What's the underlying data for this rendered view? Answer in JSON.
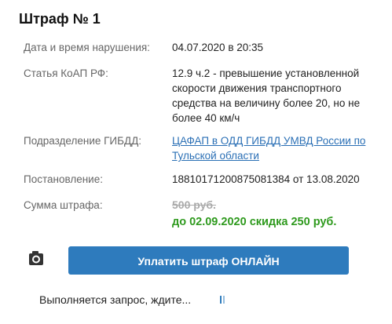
{
  "fine": {
    "title": "Штраф № 1",
    "rows": [
      {
        "label": "Дата и время нарушения:",
        "value": "04.07.2020 в 20:35"
      },
      {
        "label": "Статья КоАП РФ:",
        "value": "12.9 ч.2 - превышение установленной скорости движения транспортного средства на величину более 20, но не более 40 км/ч"
      },
      {
        "label": "Подразделение ГИБДД:",
        "value": "ЦАФАП в ОДД ГИБДД УМВД России по Тульской области"
      },
      {
        "label": "Постановление:",
        "value": "18810171200875081384 от 13.08.2020"
      },
      {
        "label": "Сумма штрафа:",
        "old_amount": "500 руб.",
        "discount_text": "до 02.09.2020 скидка 250 руб."
      }
    ]
  },
  "actions": {
    "pay_button": "Уплатить штраф ОНЛАЙН",
    "camera_icon": "camera-icon"
  },
  "status": {
    "text": "Выполняется запрос, ждите...",
    "loader_icon": "loading-spinner-icon"
  },
  "colors": {
    "accent": "#2e7bbd",
    "discount": "#2f9a1e",
    "link": "#2a6fb5"
  }
}
